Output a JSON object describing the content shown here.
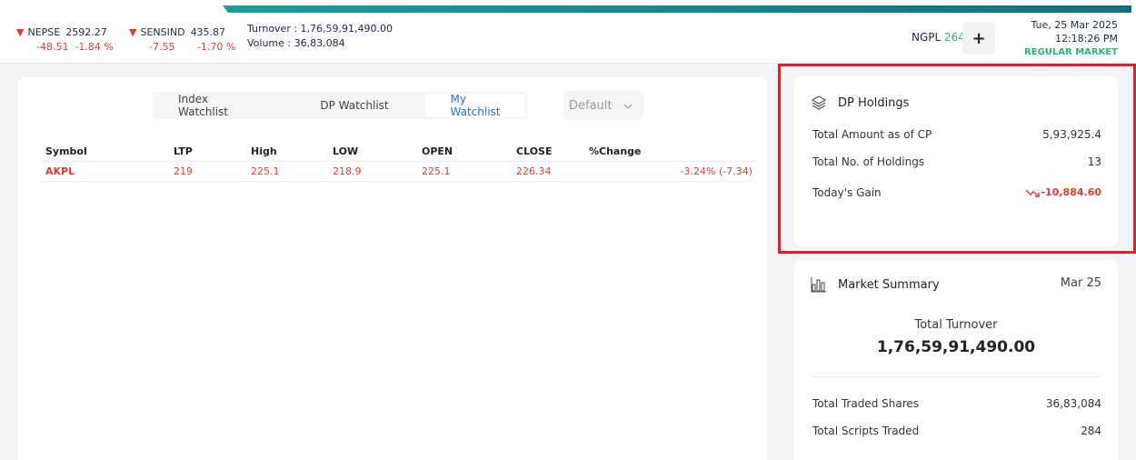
{
  "header": {
    "nepse": {
      "name": "NEPSE",
      "value": "2592.27",
      "change": "-48.51",
      "percent": "-1.84 %"
    },
    "sensind": {
      "name": "SENSIND",
      "value": "435.87",
      "change": "-7.55",
      "percent": "-1.70 %"
    },
    "turnover": "Turnover : 1,76,59,91,490.00",
    "volume": "Volume : 36,83,084",
    "ticker": {
      "symbol": "NGPL",
      "value": "264"
    },
    "plus_label": "+",
    "date": "Tue, 25 Mar 2025",
    "time": "12:18:26 PM",
    "market_status": "REGULAR MARKET",
    "colors": {
      "accent": "#1f9e99",
      "down": "#e53b2f",
      "up": "#2bb673"
    }
  },
  "watchlist": {
    "tabs": [
      {
        "label": "Index Watchlist"
      },
      {
        "label": "DP Watchlist"
      },
      {
        "label": "My Watchlist"
      }
    ],
    "active_tab": "My Watchlist",
    "dropdown": {
      "selected": "Default"
    },
    "columns": [
      "Symbol",
      "LTP",
      "High",
      "LOW",
      "OPEN",
      "CLOSE",
      "%Change"
    ],
    "rows": [
      {
        "symbol": "AKPL",
        "ltp": "219",
        "high": "225.1",
        "low": "218.9",
        "open": "225.1",
        "close": "226.34",
        "change": "-3.24% (-7.34)"
      }
    ]
  },
  "dp_holdings": {
    "title": "DP Holdings",
    "total_amount_label": "Total Amount as of CP",
    "total_amount_value": "5,93,925.4",
    "total_holdings_label": "Total No. of Holdings",
    "total_holdings_value": "13",
    "todays_gain_label": "Today's Gain",
    "todays_gain_value": "-10,884.60"
  },
  "market_summary": {
    "title": "Market Summary",
    "date": "Mar 25",
    "total_turnover_label": "Total Turnover",
    "total_turnover_value": "1,76,59,91,490.00",
    "traded_shares_label": "Total Traded Shares",
    "traded_shares_value": "36,83,084",
    "scripts_traded_label": "Total Scripts Traded",
    "scripts_traded_value": "284"
  }
}
